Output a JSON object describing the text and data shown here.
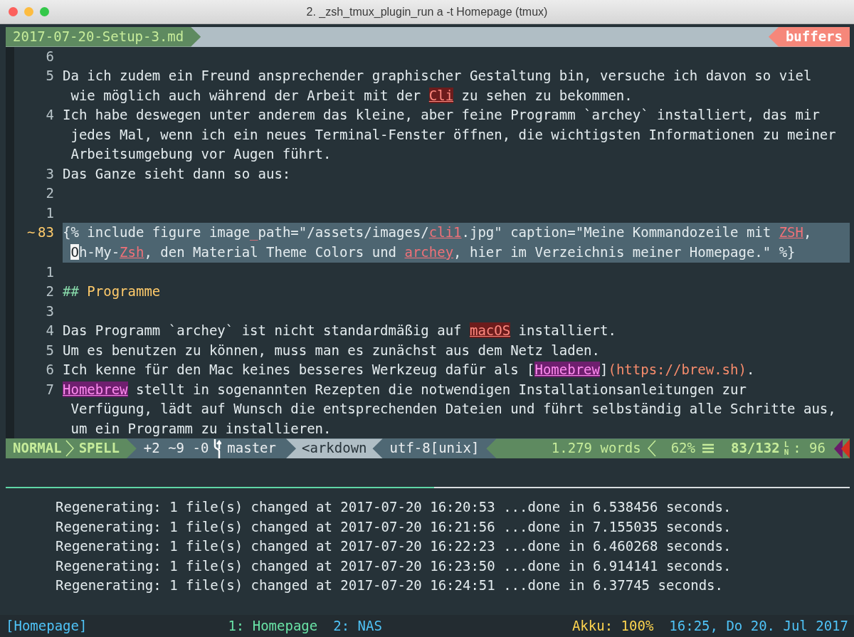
{
  "window": {
    "title": "2. _zsh_tmux_plugin_run a -t Homepage (tmux)"
  },
  "tabline": {
    "file": "2017-07-20-Setup-3.md",
    "buffers_label": "buffers"
  },
  "editor": {
    "lines": [
      {
        "number": "6",
        "current": false
      },
      {
        "number": "5",
        "current": false,
        "screen_lines": [
          {
            "segments": [
              {
                "text": "Da ich zudem ein Freund ansprechender graphischer Gestaltung bin, versuche ich davon so viel",
                "kind": "plain"
              }
            ]
          },
          {
            "segments": [
              {
                "text": "wie möglich auch während der Arbeit mit der ",
                "kind": "plain"
              },
              {
                "text": "Cli",
                "kind": "spell-bad"
              },
              {
                "text": " zu sehen zu bekommen.",
                "kind": "plain"
              }
            ]
          }
        ]
      },
      {
        "number": "4",
        "current": false,
        "screen_lines": [
          {
            "segments": [
              {
                "text": "Ich habe deswegen unter anderem das kleine, aber feine Programm `archey` installiert, das mir",
                "kind": "plain"
              }
            ]
          },
          {
            "segments": [
              {
                "text": "jedes Mal, wenn ich ein neues Terminal-Fenster öffnen, die wichtigsten Informationen zu meiner",
                "kind": "plain"
              }
            ]
          },
          {
            "segments": [
              {
                "text": "Arbeitsumgebung vor Augen führt.",
                "kind": "plain"
              }
            ]
          }
        ]
      },
      {
        "number": "3",
        "current": false,
        "screen_lines": [
          {
            "segments": [
              {
                "text": "Das Ganze sieht dann so aus:",
                "kind": "plain"
              }
            ]
          }
        ]
      },
      {
        "number": "2",
        "current": false
      },
      {
        "number": "1",
        "current": false
      },
      {
        "number": "83",
        "sign": "~",
        "current": true,
        "screen_lines": [
          {
            "segments": [
              {
                "text": "{% include figure image",
                "kind": "plain"
              },
              {
                "text": "_",
                "kind": "error"
              },
              {
                "text": "path=\"/assets/images/",
                "kind": "plain"
              },
              {
                "text": "cli1",
                "kind": "spell-rare"
              },
              {
                "text": ".jpg\" caption=\"Meine Kommandozeile mit ",
                "kind": "plain"
              },
              {
                "text": "ZSH",
                "kind": "spell-rare"
              },
              {
                "text": ",",
                "kind": "plain"
              }
            ]
          },
          {
            "segments": [
              {
                "text": "O",
                "kind": "cursor"
              },
              {
                "text": "h-My-",
                "kind": "plain"
              },
              {
                "text": "Zsh",
                "kind": "spell-rare"
              },
              {
                "text": ", den Material Theme Colors und ",
                "kind": "plain"
              },
              {
                "text": "archey",
                "kind": "spell-rare"
              },
              {
                "text": ", hier im Verzeichnis meiner Homepage.\" %}",
                "kind": "plain"
              }
            ]
          }
        ]
      },
      {
        "number": "1",
        "current": false
      },
      {
        "number": "2",
        "current": false,
        "screen_lines": [
          {
            "segments": [
              {
                "text": "## ",
                "kind": "heading-mark"
              },
              {
                "text": "Programme",
                "kind": "heading"
              }
            ]
          }
        ]
      },
      {
        "number": "3",
        "current": false
      },
      {
        "number": "4",
        "current": false,
        "screen_lines": [
          {
            "segments": [
              {
                "text": "Das Programm `archey` ist nicht standardmäßig auf ",
                "kind": "plain"
              },
              {
                "text": "macOS",
                "kind": "spell-bad"
              },
              {
                "text": " installiert.",
                "kind": "plain"
              }
            ]
          }
        ]
      },
      {
        "number": "5",
        "current": false,
        "screen_lines": [
          {
            "segments": [
              {
                "text": "Um es benutzen zu können, muss man es zunächst aus dem Netz laden.",
                "kind": "plain"
              }
            ]
          }
        ]
      },
      {
        "number": "6",
        "current": false,
        "screen_lines": [
          {
            "segments": [
              {
                "text": "Ich kenne für den Mac keines besseres Werkzeug dafür als [",
                "kind": "plain"
              },
              {
                "text": "Homebrew",
                "kind": "spell-local"
              },
              {
                "text": "]",
                "kind": "plain"
              },
              {
                "text": "(https://brew.sh)",
                "kind": "url"
              },
              {
                "text": ".",
                "kind": "plain"
              }
            ]
          }
        ]
      },
      {
        "number": "7",
        "current": false,
        "screen_lines": [
          {
            "segments": [
              {
                "text": "Homebrew",
                "kind": "spell-local"
              },
              {
                "text": " stellt in sogenannten Rezepten die notwendigen Installationsanleitungen zur",
                "kind": "plain"
              }
            ]
          },
          {
            "segments": [
              {
                "text": "Verfügung, lädt auf Wunsch die entsprechenden Dateien und führt selbständig alle Schritte aus,",
                "kind": "plain"
              }
            ]
          },
          {
            "segments": [
              {
                "text": "um ein Programm zu installieren.",
                "kind": "plain"
              }
            ]
          }
        ]
      }
    ]
  },
  "statusline": {
    "mode": "NORMAL",
    "spell": "SPELL",
    "git_changes": "+2 ~9 -0",
    "branch": "master",
    "filetype": "<arkdown",
    "encoding": "utf-8[unix]",
    "word_count": "1.279 words",
    "percent": "62%",
    "position": "83/132",
    "line_symbol": "LN",
    "column": ": 96"
  },
  "output_pane": {
    "lines": [
      "Regenerating: 1 file(s) changed at 2017-07-20 16:20:53 ...done in 6.538456 seconds.",
      "Regenerating: 1 file(s) changed at 2017-07-20 16:21:56 ...done in 7.155035 seconds.",
      "Regenerating: 1 file(s) changed at 2017-07-20 16:22:23 ...done in 6.460268 seconds.",
      "Regenerating: 1 file(s) changed at 2017-07-20 16:23:50 ...done in 6.914141 seconds.",
      "Regenerating: 1 file(s) changed at 2017-07-20 16:24:51 ...done in 6.37745 seconds."
    ]
  },
  "tmux_bar": {
    "session": "[Homepage]",
    "windows": [
      {
        "label": "1: Homepage",
        "selected": true
      },
      {
        "label": "2: NAS",
        "selected": false
      }
    ],
    "battery_label": "Akku:",
    "battery_value": "100%",
    "clock": "16:25, Do 20. Jul 2017"
  }
}
